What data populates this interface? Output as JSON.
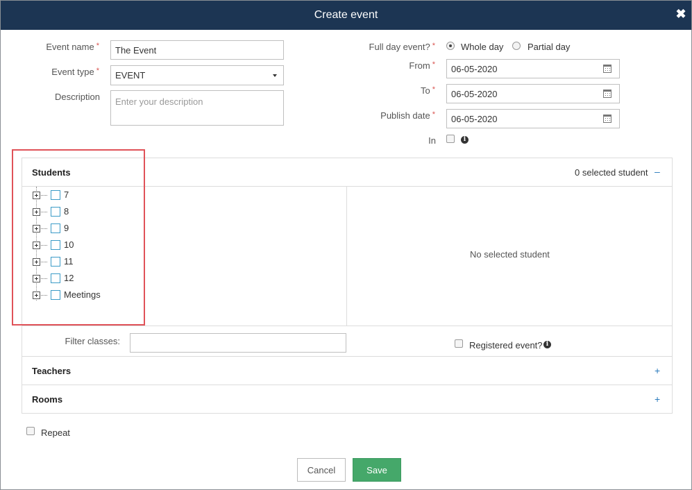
{
  "header": {
    "title": "Create event",
    "close_icon": "close-icon"
  },
  "form": {
    "event_name": {
      "label": "Event name",
      "value": "The Event"
    },
    "event_type": {
      "label": "Event type",
      "value": "EVENT"
    },
    "description": {
      "label": "Description",
      "placeholder": "Enter your description"
    },
    "full_day": {
      "label": "Full day event?",
      "option_whole": "Whole day",
      "option_partial": "Partial day",
      "selected": "Whole day"
    },
    "from": {
      "label": "From",
      "value": "06-05-2020"
    },
    "to": {
      "label": "To",
      "value": "06-05-2020"
    },
    "publish_date": {
      "label": "Publish date",
      "value": "06-05-2020"
    },
    "in": {
      "label": "In",
      "checked": false
    }
  },
  "students": {
    "title": "Students",
    "selected_count": "0 selected student",
    "collapse_symbol": "–",
    "tree": [
      "7",
      "8",
      "9",
      "10",
      "11",
      "12",
      "Meetings"
    ],
    "empty_message": "No selected student",
    "filter_label": "Filter classes:",
    "filter_value": "",
    "registered_label": "Registered event?"
  },
  "teachers": {
    "title": "Teachers",
    "expand_symbol": "+"
  },
  "rooms": {
    "title": "Rooms",
    "expand_symbol": "+"
  },
  "repeat": {
    "label": "Repeat",
    "checked": false
  },
  "buttons": {
    "cancel": "Cancel",
    "save": "Save"
  },
  "colors": {
    "header_bg": "#1c3553",
    "save_bg": "#45a86a",
    "highlight": "#e05258",
    "link": "#2a7bbd"
  }
}
